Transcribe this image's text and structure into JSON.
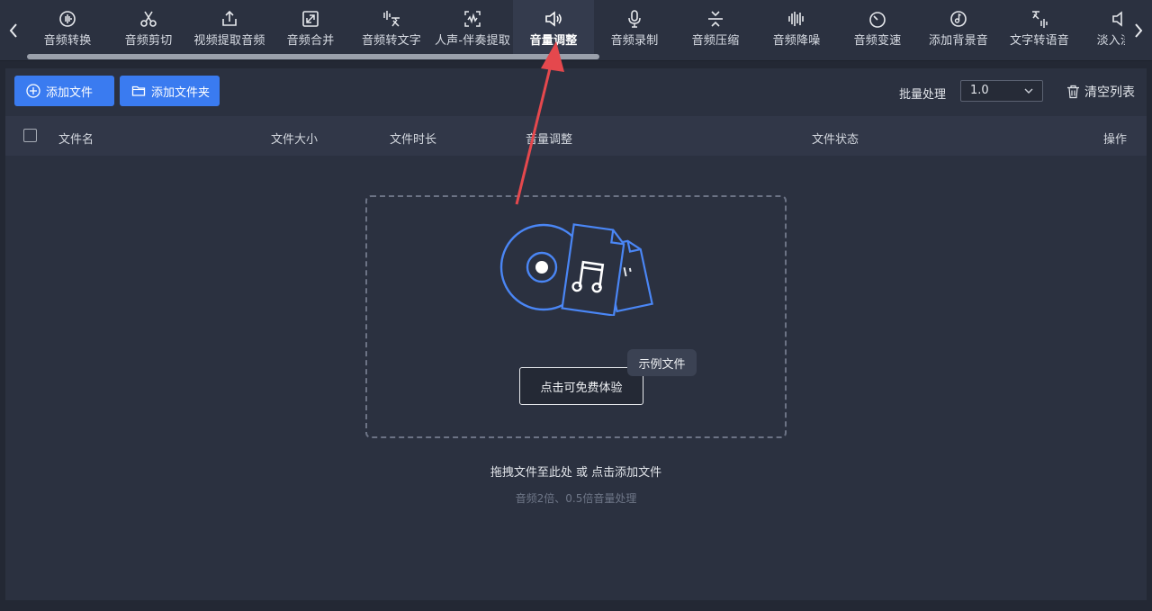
{
  "toolbar": {
    "tools": [
      {
        "label": "音频转换",
        "icon": "audio-convert-icon"
      },
      {
        "label": "音频剪切",
        "icon": "scissors-icon"
      },
      {
        "label": "视频提取音频",
        "icon": "export-icon"
      },
      {
        "label": "音频合并",
        "icon": "merge-icon"
      },
      {
        "label": "音频转文字",
        "icon": "speech-to-text-icon"
      },
      {
        "label": "人声-伴奏提取",
        "icon": "vocal-extract-icon"
      },
      {
        "label": "音量调整",
        "icon": "volume-icon"
      },
      {
        "label": "音频录制",
        "icon": "microphone-icon"
      },
      {
        "label": "音频压缩",
        "icon": "compress-icon"
      },
      {
        "label": "音频降噪",
        "icon": "denoise-icon"
      },
      {
        "label": "音频变速",
        "icon": "speed-icon"
      },
      {
        "label": "添加背景音",
        "icon": "background-music-icon"
      },
      {
        "label": "文字转语音",
        "icon": "text-to-speech-icon"
      },
      {
        "label": "淡入淡出",
        "icon": "fade-icon"
      }
    ],
    "active_tool": "音量调整"
  },
  "actions": {
    "add_file": "添加文件",
    "add_folder": "添加文件夹",
    "batch_label": "批量处理",
    "batch_value": "1.0",
    "clear_list": "清空列表"
  },
  "table": {
    "columns": [
      "文件名",
      "文件大小",
      "文件时长",
      "音量调整",
      "文件状态",
      "操作"
    ]
  },
  "dropzone": {
    "try_button": "点击可免费体验",
    "sample_tag": "示例文件",
    "hint": "拖拽文件至此处 或 点击添加文件",
    "subhint": "音频2倍、0.5倍音量处理"
  },
  "colors": {
    "accent": "#3a7bf0",
    "background": "#232834",
    "panel": "#2b3140",
    "annotation": "#e5484d"
  }
}
